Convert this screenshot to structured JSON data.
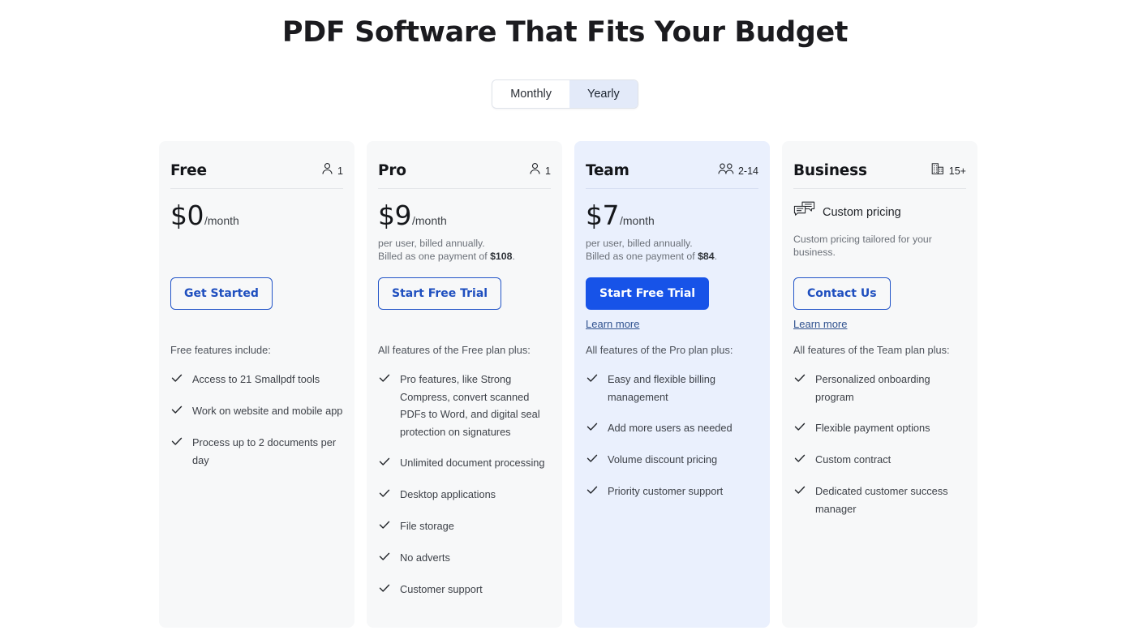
{
  "headline": "PDF Software That Fits Your Budget",
  "billing_toggle": {
    "options": [
      {
        "label": "Monthly",
        "active": false
      },
      {
        "label": "Yearly",
        "active": true
      }
    ],
    "selected": "Yearly"
  },
  "colors": {
    "accent_blue": "#1753e8",
    "outline_blue": "#2456c8",
    "link_blue": "#30528f",
    "card_bg": "#f7f8f9",
    "card_bg_highlight": "#eaf0fd",
    "toggle_active_bg": "#e3eaf9",
    "heading": "#1b1b1f"
  },
  "plans": [
    {
      "name": "Free",
      "seats": "1",
      "seats_icon": "single-person-icon",
      "price_amount": "$0",
      "price_period": "/month",
      "price_note_line1": "",
      "price_note_line2_prefix": "",
      "price_note_total": "",
      "price_note_suffix": "",
      "cta_label": "Get Started",
      "cta_style": "outline",
      "learn_more": "",
      "features_title": "Free features include:",
      "features": [
        "Access to 21 Smallpdf tools",
        "Work on website and mobile app",
        "Process up to 2 documents per day"
      ]
    },
    {
      "name": "Pro",
      "seats": "1",
      "seats_icon": "single-person-icon",
      "price_amount": "$9",
      "price_period": "/month",
      "price_note_line1": "per user, billed annually.",
      "price_note_line2_prefix": "Billed as one payment of ",
      "price_note_total": "$108",
      "price_note_suffix": ".",
      "cta_label": "Start Free Trial",
      "cta_style": "outline",
      "learn_more": "",
      "features_title": "All features of the Free plan plus:",
      "features": [
        "Pro features, like Strong Compress, convert scanned PDFs to Word, and digital seal protection on signatures",
        "Unlimited document processing",
        "Desktop applications",
        "File storage",
        "No adverts",
        "Customer support"
      ]
    },
    {
      "name": "Team",
      "seats": "2-14",
      "seats_icon": "two-people-icon",
      "price_amount": "$7",
      "price_period": "/month",
      "price_note_line1": "per user, billed annually.",
      "price_note_line2_prefix": "Billed as one payment of ",
      "price_note_total": "$84",
      "price_note_suffix": ".",
      "cta_label": "Start Free Trial",
      "cta_style": "solid",
      "learn_more": "Learn more",
      "features_title": "All features of the Pro plan plus:",
      "features": [
        "Easy and flexible billing management",
        "Add more users as needed",
        "Volume discount pricing",
        "Priority customer support"
      ]
    },
    {
      "name": "Business",
      "seats": "15+",
      "seats_icon": "building-icon",
      "custom_pricing_label": "Custom pricing",
      "custom_pricing_icon": "chat-bubbles-icon",
      "custom_pricing_desc": "Custom pricing tailored for your business.",
      "cta_label": "Contact Us",
      "cta_style": "outline",
      "learn_more": "Learn more",
      "features_title": "All features of the Team plan plus:",
      "features": [
        "Personalized onboarding program",
        "Flexible payment options",
        "Custom contract",
        "Dedicated customer success manager"
      ]
    }
  ]
}
